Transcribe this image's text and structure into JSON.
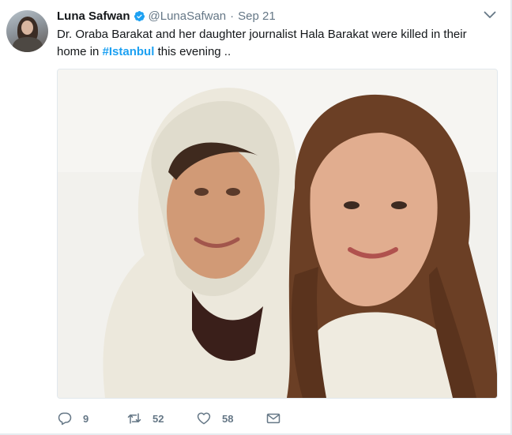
{
  "tweet": {
    "author_name": "Luna Safwan",
    "handle": "@LunaSafwan",
    "separator": "·",
    "time": "Sep 21",
    "verified": true,
    "text_part1": "Dr. Oraba Barakat and her daughter journalist Hala Barakat were killed in their home in ",
    "hashtag": "#Istanbul",
    "text_part2": " this evening .."
  },
  "actions": {
    "reply_count": "9",
    "retweet_count": "52",
    "like_count": "58"
  },
  "colors": {
    "accent": "#1da1f2",
    "secondary_text": "#657786",
    "border": "#e1e8ed"
  },
  "icons": {
    "verified": "verified-badge-icon",
    "caret": "chevron-down-icon",
    "reply": "reply-icon",
    "retweet": "retweet-icon",
    "like": "heart-icon",
    "message": "envelope-icon"
  }
}
